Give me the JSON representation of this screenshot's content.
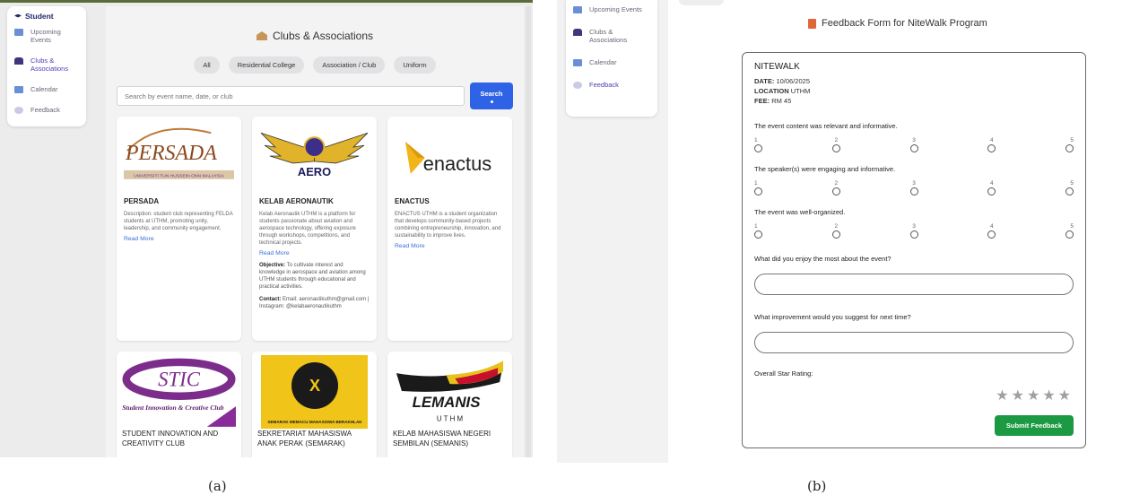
{
  "panel_a": {
    "sidebar": {
      "role": "Student",
      "items": [
        {
          "label": "Upcoming Events",
          "icon": "calendar-icon"
        },
        {
          "label": "Clubs & Associations",
          "icon": "group-icon"
        },
        {
          "label": "Calendar",
          "icon": "calendar-icon"
        },
        {
          "label": "Feedback",
          "icon": "feedback-icon"
        }
      ]
    },
    "title": "Clubs & Associations",
    "filters": [
      "All",
      "Residential College",
      "Association / Club",
      "Uniform"
    ],
    "search": {
      "placeholder": "Search by event name, date, or club",
      "button": "Search"
    },
    "cards": [
      {
        "logo_text": "PERSADA",
        "logo_tagline": "UNIVERSITI TUN HUSSEIN ONN MALAYSIA",
        "name": "PERSADA",
        "description": "Description: student club representing FELDA students at UTHM, promoting unity, leadership, and community engagement.",
        "link": "Read More"
      },
      {
        "logo_text": "AERO",
        "name": "KELAB AERONAUTIK",
        "description": "Kelab Aeronautik UTHM is a platform for students passionate about aviation and aerospace technology, offering exposure through workshops, competitions, and technical projects.",
        "link": "Read More",
        "objective_label": "Objective:",
        "objective": "To cultivate interest and knowledge in aerospace and aviation among UTHM students through educational and practical activities.",
        "contact_label": "Contact:",
        "contact": "Email: aeronautikuthm@gmail.com | Instagram: @kelabaeronautikuthm"
      },
      {
        "logo_text": "enactus",
        "name": "ENACTUS",
        "description": "ENACTUS UTHM is a student organization that develops community-based projects combining entrepreneurship, innovation, and sustainability to improve lives.",
        "link": "Read More"
      },
      {
        "logo_text": "STIC",
        "logo_sub": "Student Innovation & Creative Club",
        "name": "STUDENT INNOVATION AND CREATIVITY CLUB"
      },
      {
        "logo_text": "SEMARAK MEMACU MAHASISWA BERAKHLAK",
        "name": "SEKRETARIAT MAHASISWA ANAK PERAK (SEMARAK)"
      },
      {
        "logo_text": "LEMANIS",
        "logo_sub": "U T H M",
        "name": "KELAB MAHASISWA NEGERI SEMBILAN (SEMANIS)"
      }
    ]
  },
  "panel_b": {
    "sidebar": {
      "items": [
        {
          "label": "Upcoming Events",
          "icon": "calendar-icon"
        },
        {
          "label": "Clubs & Associations",
          "icon": "group-icon"
        },
        {
          "label": "Calendar",
          "icon": "calendar-icon"
        },
        {
          "label": "Feedback",
          "icon": "feedback-icon"
        }
      ]
    },
    "title": "Feedback Form for NiteWalk Program",
    "event": {
      "name": "NITEWALK",
      "date_label": "DATE:",
      "date": "10/06/2025",
      "location_label": "LOCATION",
      "location": "UTHM",
      "fee_label": "FEE:",
      "fee": "RM 45"
    },
    "questions": [
      "The event content was relevant and informative.",
      "The speaker(s) were engaging and informative.",
      "The event was well-organized."
    ],
    "scale": [
      "1",
      "2",
      "3",
      "4",
      "5"
    ],
    "open_questions": [
      "What did you enjoy the most about the event?",
      "What improvement would you suggest for next time?"
    ],
    "rating_label": "Overall Star Rating:",
    "stars": "★★★★★",
    "submit": "Submit Feedback"
  },
  "captions": [
    "(a)",
    "(b)"
  ],
  "colors": {
    "primary": "#2f63e6",
    "submit": "#1b9a43",
    "accent": "#4b3fb5"
  }
}
